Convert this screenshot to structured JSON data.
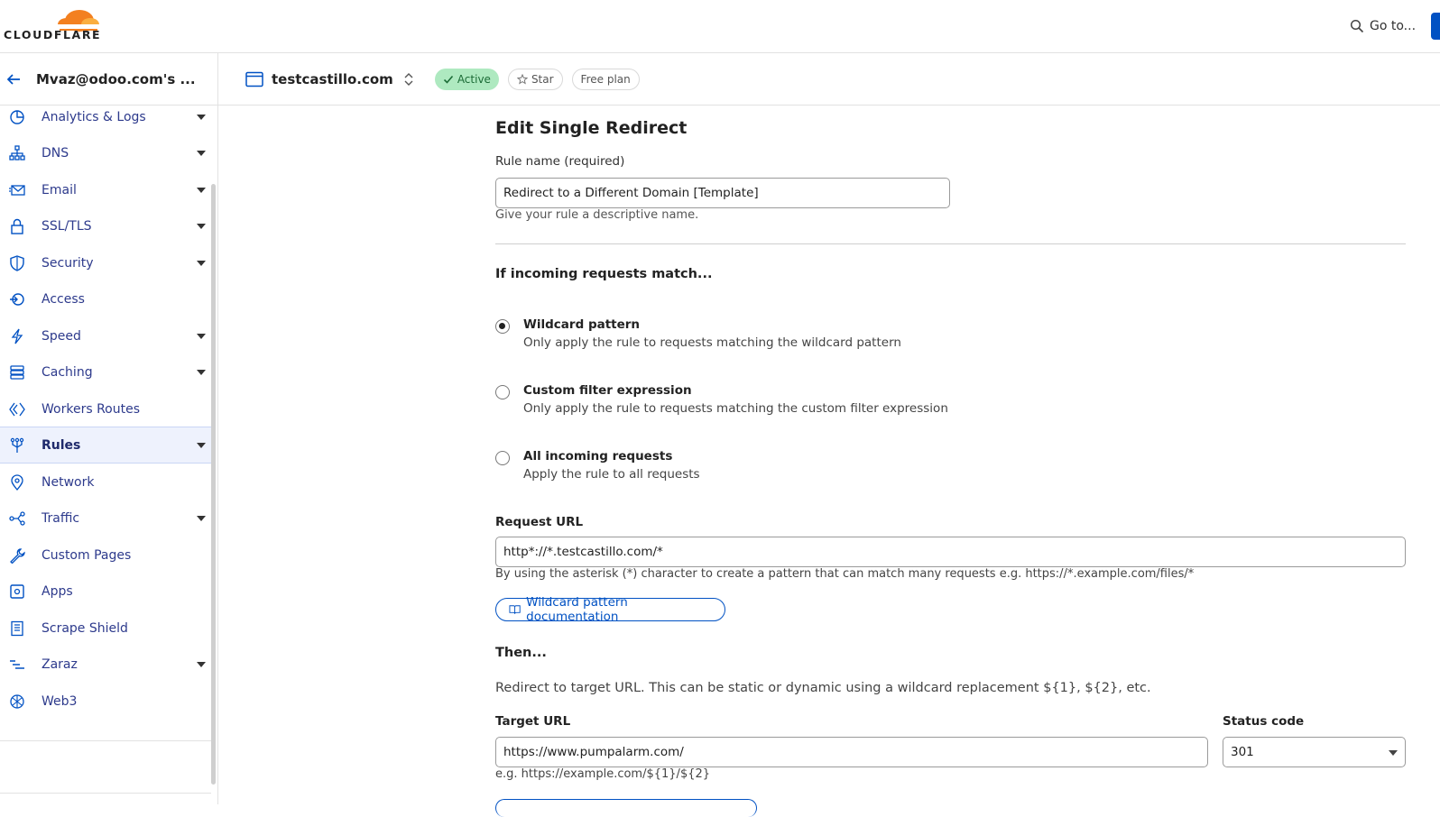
{
  "brand": {
    "logo_text": "CLOUDFLARE",
    "accent": "#f38020",
    "primary_blue": "#0051c3"
  },
  "topbar": {
    "goto_label": "Go to..."
  },
  "account": {
    "name": "Mvaz@odoo.com's ..."
  },
  "zone": {
    "name": "testcastillo.com",
    "status": "Active",
    "star_label": "Star",
    "plan": "Free plan"
  },
  "sidebar": {
    "items": [
      {
        "label": "Analytics & Logs",
        "icon": "chart-pie-icon",
        "expandable": true
      },
      {
        "label": "DNS",
        "icon": "network-tree-icon",
        "expandable": true
      },
      {
        "label": "Email",
        "icon": "email-icon",
        "expandable": true
      },
      {
        "label": "SSL/TLS",
        "icon": "lock-icon",
        "expandable": true
      },
      {
        "label": "Security",
        "icon": "shield-icon",
        "expandable": true
      },
      {
        "label": "Access",
        "icon": "access-icon",
        "expandable": false
      },
      {
        "label": "Speed",
        "icon": "lightning-icon",
        "expandable": true
      },
      {
        "label": "Caching",
        "icon": "server-stack-icon",
        "expandable": true
      },
      {
        "label": "Workers Routes",
        "icon": "workers-icon",
        "expandable": false
      },
      {
        "label": "Rules",
        "icon": "rules-fork-icon",
        "expandable": true,
        "active": true
      },
      {
        "label": "Network",
        "icon": "map-pin-icon",
        "expandable": false
      },
      {
        "label": "Traffic",
        "icon": "traffic-icon",
        "expandable": true
      },
      {
        "label": "Custom Pages",
        "icon": "wrench-icon",
        "expandable": false
      },
      {
        "label": "Apps",
        "icon": "apps-icon",
        "expandable": false
      },
      {
        "label": "Scrape Shield",
        "icon": "document-icon",
        "expandable": false
      },
      {
        "label": "Zaraz",
        "icon": "zaraz-icon",
        "expandable": true
      },
      {
        "label": "Web3",
        "icon": "web3-icon",
        "expandable": false
      }
    ]
  },
  "form": {
    "title": "Edit Single Redirect",
    "rule_name_label": "Rule name (required)",
    "rule_name_value": "Redirect to a Different Domain [Template]",
    "rule_name_help": "Give your rule a descriptive name.",
    "match_heading": "If incoming requests match...",
    "options": [
      {
        "title": "Wildcard pattern",
        "desc": "Only apply the rule to requests matching the wildcard pattern",
        "checked": true
      },
      {
        "title": "Custom filter expression",
        "desc": "Only apply the rule to requests matching the custom filter expression",
        "checked": false
      },
      {
        "title": "All incoming requests",
        "desc": "Apply the rule to all requests",
        "checked": false
      }
    ],
    "request_url_label": "Request URL",
    "request_url_value": "http*://*.testcastillo.com/*",
    "request_url_help": "By using the asterisk (*) character to create a pattern that can match many requests e.g. https://*.example.com/files/*",
    "doc_button_label": "Wildcard pattern documentation",
    "then_heading": "Then...",
    "then_desc": "Redirect to target URL. This can be static or dynamic using a wildcard replacement ${1}, ${2}, etc.",
    "target_url_label": "Target URL",
    "target_url_value": "https://www.pumpalarm.com/",
    "target_url_help": "e.g. https://example.com/${1}/${2}",
    "status_code_label": "Status code",
    "status_code_value": "301"
  }
}
